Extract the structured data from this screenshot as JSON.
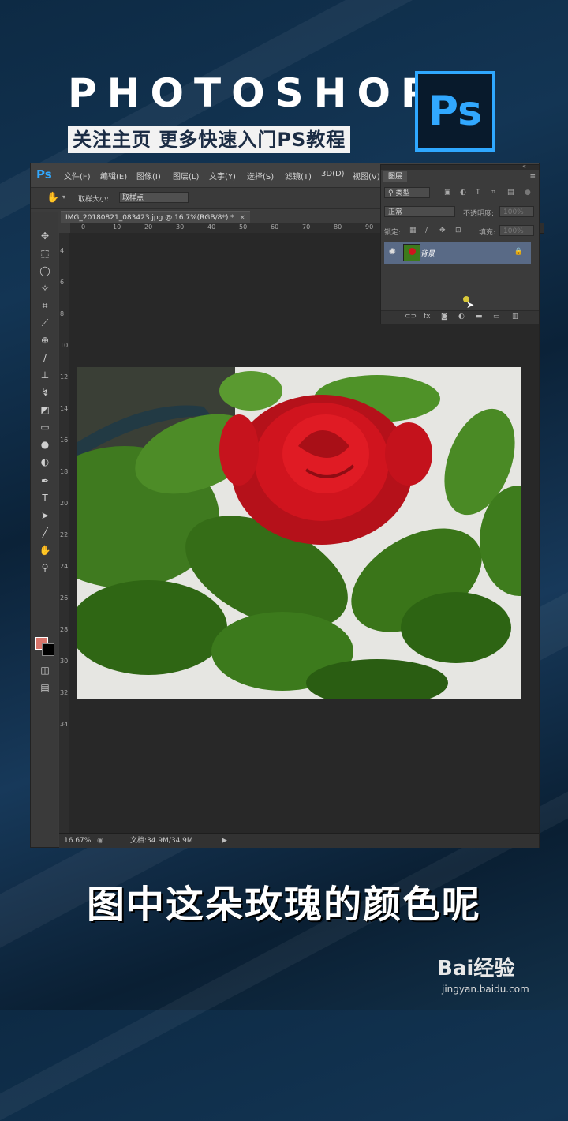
{
  "header": {
    "title": "PHOTOSHOP",
    "subtitle": "关注主页  更多快速入门PS教程",
    "logo": "Ps"
  },
  "app": {
    "logo": "Ps",
    "menu": [
      "文件(F)",
      "编辑(E)",
      "图像(I)",
      "图层(L)",
      "文字(Y)",
      "选择(S)",
      "滤镜(T)",
      "3D(D)",
      "视图(V)"
    ],
    "options": {
      "sample_size_label": "取样大小:",
      "sample_size_value": "取样点"
    },
    "document_tab": "IMG_20180821_083423.jpg @ 16.7%(RGB/8*) *",
    "ruler_h": [
      "0",
      "10",
      "20",
      "30",
      "40",
      "50",
      "60",
      "70",
      "80",
      "90"
    ],
    "ruler_v": [
      "4",
      "6",
      "8",
      "10",
      "12",
      "14",
      "16",
      "18",
      "20",
      "22",
      "24",
      "26",
      "28",
      "30",
      "32",
      "34"
    ],
    "status": {
      "zoom": "16.67%",
      "doc": "文档:34.9M/34.9M"
    }
  },
  "layers_panel": {
    "tab": "图层",
    "filter": "类型",
    "blend_mode": "正常",
    "opacity_label": "不透明度:",
    "opacity_value": "100%",
    "lock_label": "锁定:",
    "fill_label": "填充:",
    "fill_value": "100%",
    "layer_name": "背景",
    "footer_icons": [
      "link-icon",
      "fx-icon",
      "mask-icon",
      "adjustment-icon",
      "folder-icon",
      "new-layer-icon",
      "trash-icon"
    ]
  },
  "caption": "图中这朵玫瑰的颜色呢",
  "watermark": {
    "brand": "Bai经验",
    "url": "jingyan.baidu.com"
  },
  "colors": {
    "ps_blue": "#31a8ff",
    "foreground_swatch": "#d8746a",
    "background_swatch": "#000000",
    "layer_selected": "#596a86"
  }
}
